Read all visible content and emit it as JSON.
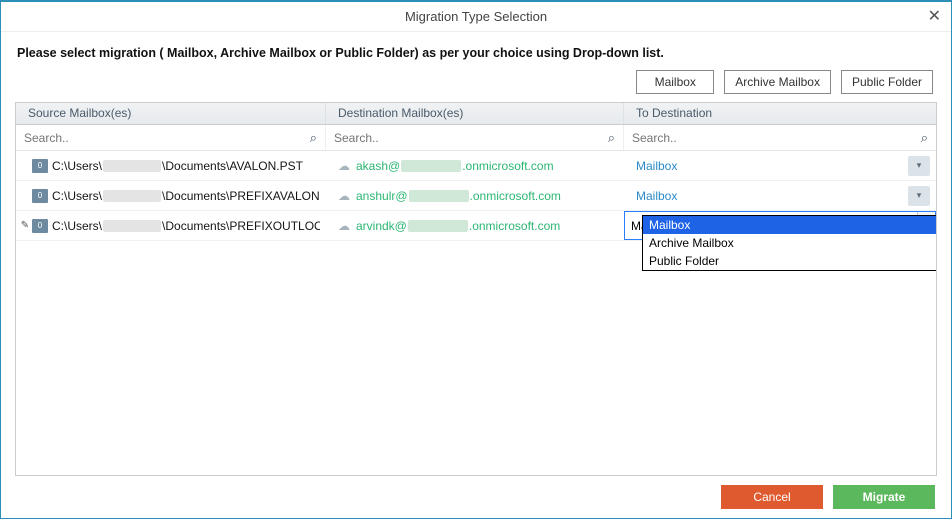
{
  "titlebar": {
    "title": "Migration Type Selection"
  },
  "instruction": "Please select migration ( Mailbox, Archive Mailbox or Public Folder) as per your choice using Drop-down list.",
  "typeButtons": {
    "mailbox": "Mailbox",
    "archive": "Archive Mailbox",
    "pub": "Public Folder"
  },
  "headers": {
    "source": "Source Mailbox(es)",
    "dest": "Destination Mailbox(es)",
    "todest": "To Destination"
  },
  "search": {
    "placeholder": "Search.."
  },
  "rows": [
    {
      "editing": false,
      "src_pre": "C:\\Users\\",
      "src_post": "\\Documents\\AVALON.PST",
      "dest_pre": "akash@",
      "dest_post": ".onmicrosoft.com",
      "todest": "Mailbox"
    },
    {
      "editing": false,
      "src_pre": "C:\\Users\\",
      "src_post": "\\Documents\\PREFIXAVALON....",
      "dest_pre": "anshulr@",
      "dest_post": ".onmicrosoft.com",
      "todest": "Mailbox"
    },
    {
      "editing": true,
      "src_pre": "C:\\Users\\",
      "src_post": "\\Documents\\PREFIXOUTLOO...",
      "dest_pre": "arvindk@",
      "dest_post": ".onmicrosoft.com",
      "todest": "Mailbox"
    }
  ],
  "dropdown": {
    "options": [
      "Mailbox",
      "Archive Mailbox",
      "Public Folder"
    ],
    "selected": "Mailbox"
  },
  "footer": {
    "cancel": "Cancel",
    "migrate": "Migrate"
  },
  "icons": {
    "file_badge": "0",
    "close": "✕",
    "search": "⌕",
    "cloud": "☁",
    "pencil": "✎",
    "chev": "▾"
  }
}
